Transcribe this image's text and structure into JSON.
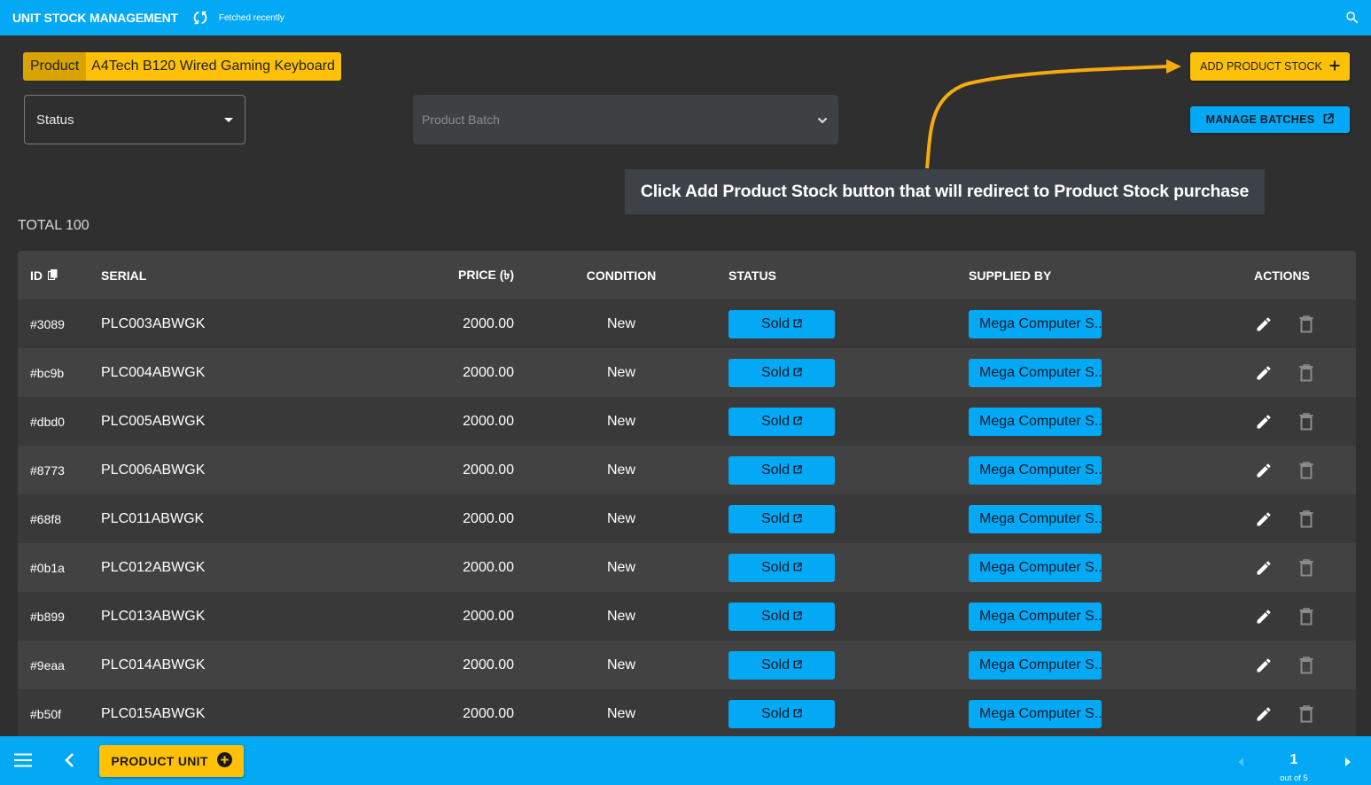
{
  "header": {
    "title": "UNIT STOCK MANAGEMENT",
    "fetch_status": "Fetched recently"
  },
  "product": {
    "label": "Product",
    "value": "A4Tech B120 Wired Gaming Keyboard"
  },
  "filters": {
    "status_label": "Status",
    "batch_placeholder": "Product Batch"
  },
  "buttons": {
    "add_product_stock": "ADD PRODUCT STOCK",
    "manage_batches": "MANAGE BATCHES",
    "product_unit": "PRODUCT UNIT"
  },
  "annotation": {
    "text": "Click Add Product Stock button that will redirect to Product Stock purchase"
  },
  "total_label": "TOTAL 100",
  "table": {
    "headers": {
      "id": "ID",
      "serial": "SERIAL",
      "price": "PRICE (৳)",
      "condition": "CONDITION",
      "status": "STATUS",
      "supplied_by": "SUPPLIED BY",
      "actions": "ACTIONS"
    },
    "rows": [
      {
        "id": "#3089",
        "serial": "PLC003ABWGK",
        "price": "2000.00",
        "condition": "New",
        "status": "Sold",
        "supplier": "Mega Computer S.."
      },
      {
        "id": "#bc9b",
        "serial": "PLC004ABWGK",
        "price": "2000.00",
        "condition": "New",
        "status": "Sold",
        "supplier": "Mega Computer S.."
      },
      {
        "id": "#dbd0",
        "serial": "PLC005ABWGK",
        "price": "2000.00",
        "condition": "New",
        "status": "Sold",
        "supplier": "Mega Computer S.."
      },
      {
        "id": "#8773",
        "serial": "PLC006ABWGK",
        "price": "2000.00",
        "condition": "New",
        "status": "Sold",
        "supplier": "Mega Computer S.."
      },
      {
        "id": "#68f8",
        "serial": "PLC011ABWGK",
        "price": "2000.00",
        "condition": "New",
        "status": "Sold",
        "supplier": "Mega Computer S.."
      },
      {
        "id": "#0b1a",
        "serial": "PLC012ABWGK",
        "price": "2000.00",
        "condition": "New",
        "status": "Sold",
        "supplier": "Mega Computer S.."
      },
      {
        "id": "#b899",
        "serial": "PLC013ABWGK",
        "price": "2000.00",
        "condition": "New",
        "status": "Sold",
        "supplier": "Mega Computer S.."
      },
      {
        "id": "#9eaa",
        "serial": "PLC014ABWGK",
        "price": "2000.00",
        "condition": "New",
        "status": "Sold",
        "supplier": "Mega Computer S.."
      },
      {
        "id": "#b50f",
        "serial": "PLC015ABWGK",
        "price": "2000.00",
        "condition": "New",
        "status": "Sold",
        "supplier": "Mega Computer S.."
      }
    ]
  },
  "pagination": {
    "current_page": "1",
    "out_of": "out of 5"
  },
  "colors": {
    "primary": "#03a9f4",
    "accent": "#ffc107",
    "background": "#2f2f2f"
  }
}
